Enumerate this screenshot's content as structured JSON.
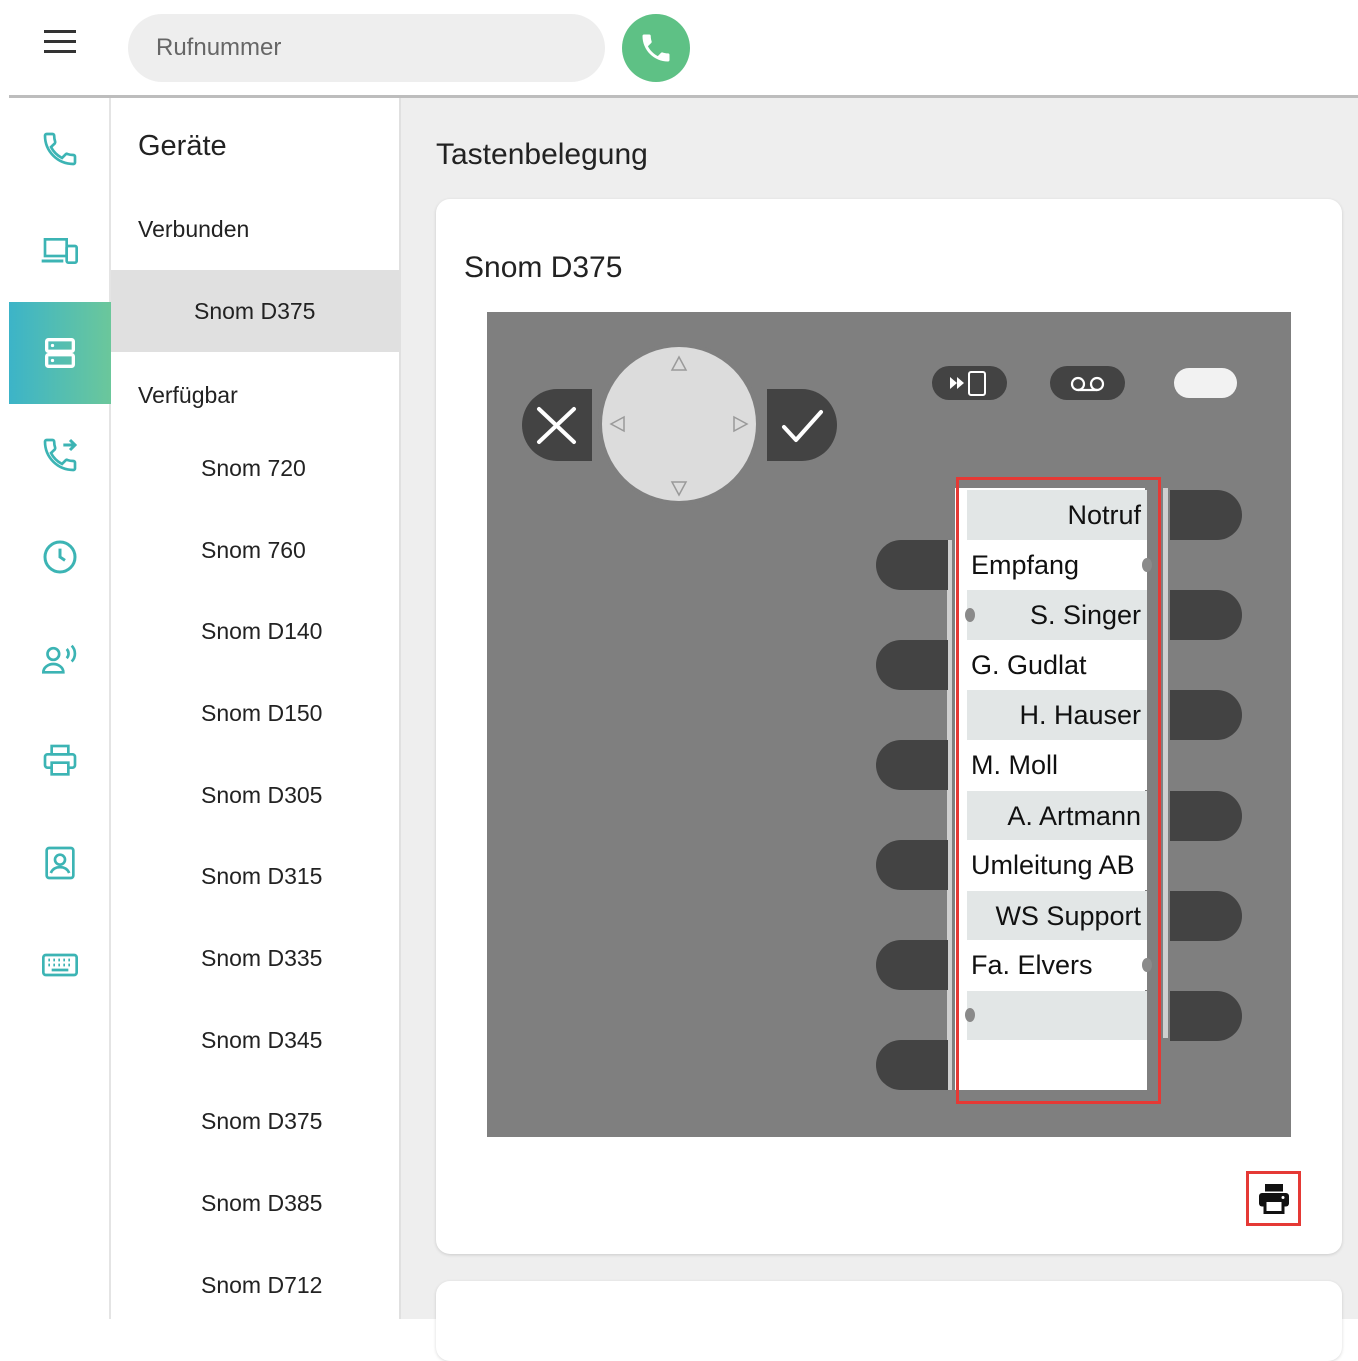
{
  "header": {
    "search_placeholder": "Rufnummer"
  },
  "rail": {
    "items": [
      {
        "icon": "phone-icon"
      },
      {
        "icon": "devices-icon"
      },
      {
        "icon": "server-icon",
        "active": true
      },
      {
        "icon": "call-forward-icon"
      },
      {
        "icon": "clock-icon"
      },
      {
        "icon": "user-voice-icon"
      },
      {
        "icon": "printer-icon"
      },
      {
        "icon": "contact-icon"
      },
      {
        "icon": "keyboard-icon"
      }
    ],
    "accent_from": "#3cb4c8",
    "accent_to": "#6bc79b"
  },
  "devices": {
    "heading": "Geräte",
    "connected_label": "Verbunden",
    "connected": [
      "Snom D375"
    ],
    "available_label": "Verfügbar",
    "available": [
      "Snom 720",
      "Snom 760",
      "Snom D140",
      "Snom D150",
      "Snom D305",
      "Snom D315",
      "Snom D335",
      "Snom D345",
      "Snom D375",
      "Snom D385",
      "Snom D712"
    ]
  },
  "main": {
    "title": "Tastenbelegung",
    "device_title": "Snom D375"
  },
  "keys": {
    "right": [
      "Notruf",
      "S. Singer",
      "H. Hauser",
      "A. Artmann",
      "WS Support",
      ""
    ],
    "left": [
      "Empfang",
      "G. Gudlat",
      "M. Moll",
      "Umleitung AB",
      "Fa. Elvers",
      ""
    ]
  },
  "colors": {
    "call_button": "#5ec185",
    "highlight": "#e53935",
    "phone_body": "#7f7f7f"
  }
}
